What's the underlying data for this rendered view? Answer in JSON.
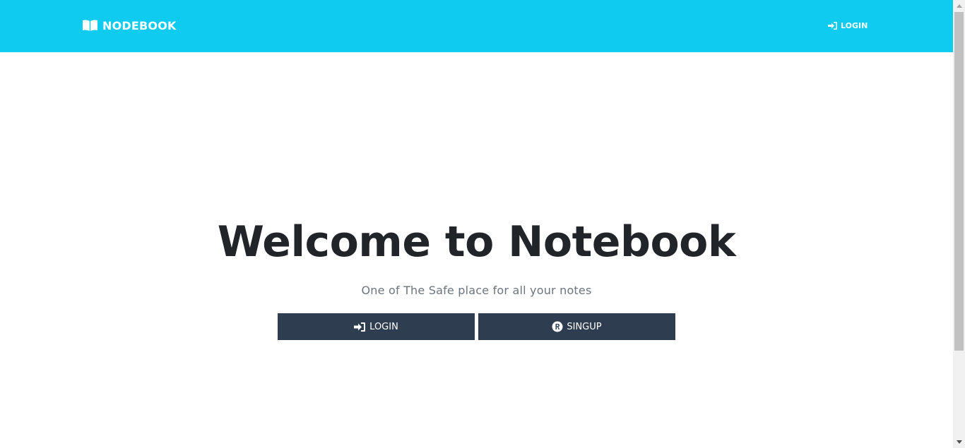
{
  "navbar": {
    "brand_label": "NODEBOOK",
    "brand_icon": "book-open-icon",
    "login_label": "LOGIN",
    "login_icon": "sign-in-icon",
    "background_color": "#0fcbf0"
  },
  "hero": {
    "title": "Welcome to Notebook",
    "subtitle": "One of The Safe place for all your notes",
    "buttons": [
      {
        "label": "LOGIN",
        "icon": "sign-in-icon"
      },
      {
        "label": "SINGUP",
        "icon": "registered-icon"
      }
    ],
    "button_color": "#2e3e50"
  }
}
